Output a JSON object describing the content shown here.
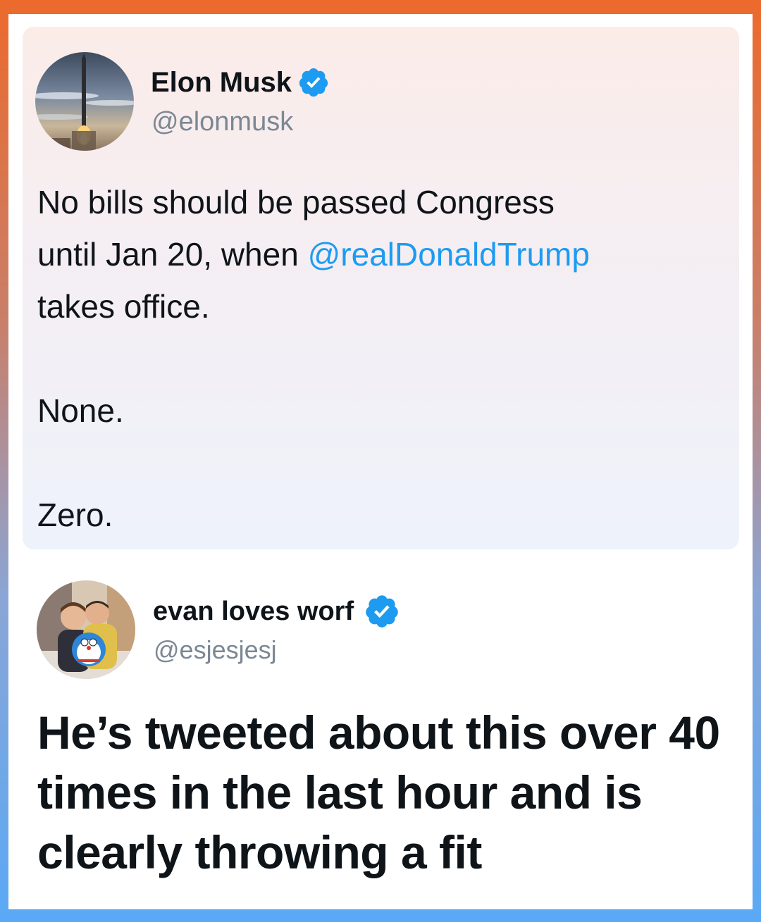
{
  "quoted_tweet": {
    "author": {
      "display_name": "Elon Musk",
      "handle": "@elonmusk",
      "verified": true,
      "avatar_icon": "rocket-launch-avatar"
    },
    "text": {
      "line1": "No bills should be passed Congress",
      "line2_prefix": "until Jan 20, when ",
      "mention": "@realDonaldTrump",
      "line3": "takes office.",
      "para2": "None.",
      "para3": "Zero."
    }
  },
  "reply_tweet": {
    "author": {
      "display_name": "evan loves worf",
      "handle": "@esjesjesj",
      "verified": true,
      "avatar_icon": "two-people-with-plush-avatar"
    },
    "text": "He’s tweeted about this over 40 times in the last hour and is clearly throwing a fit"
  },
  "colors": {
    "verified_badge": "#1d9bf0",
    "mention": "#1d9bf0",
    "handle_gray": "#7b8794",
    "frame_gradient_top": "#ec6a2c",
    "frame_gradient_bottom": "#5aa9f6"
  }
}
